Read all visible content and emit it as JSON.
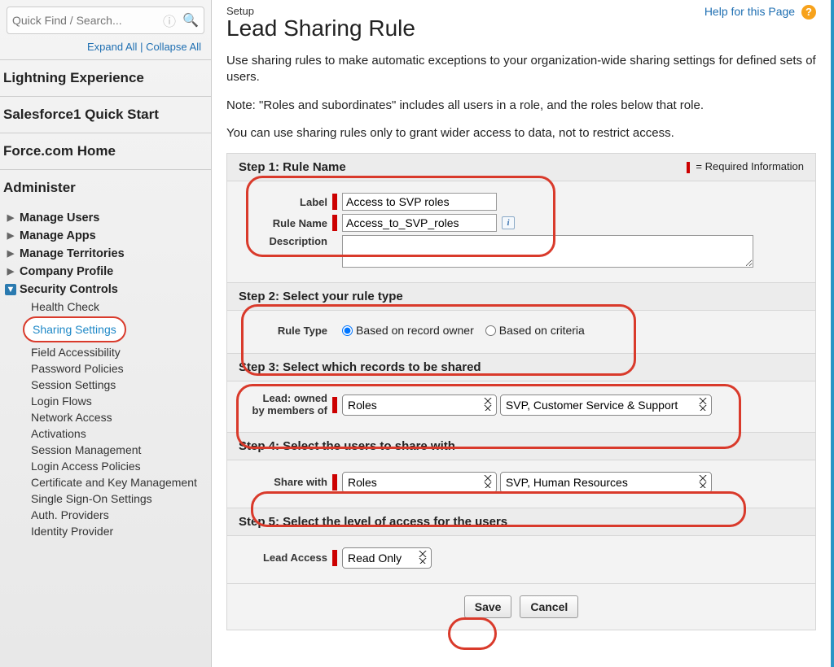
{
  "sidebar": {
    "search_placeholder": "Quick Find / Search...",
    "expand_all": "Expand All",
    "collapse_all": "Collapse All",
    "sections": [
      {
        "label": "Lightning Experience"
      },
      {
        "label": "Salesforce1 Quick Start"
      },
      {
        "label": "Force.com Home"
      }
    ],
    "administer_label": "Administer",
    "tree": [
      {
        "label": "Manage Users",
        "expanded": false
      },
      {
        "label": "Manage Apps",
        "expanded": false
      },
      {
        "label": "Manage Territories",
        "expanded": false
      },
      {
        "label": "Company Profile",
        "expanded": false
      },
      {
        "label": "Security Controls",
        "expanded": true,
        "children": [
          "Health Check",
          "Sharing Settings",
          "Field Accessibility",
          "Password Policies",
          "Session Settings",
          "Login Flows",
          "Network Access",
          "Activations",
          "Session Management",
          "Login Access Policies",
          "Certificate and Key Management",
          "Single Sign-On Settings",
          "Auth. Providers",
          "Identity Provider"
        ],
        "active_child_index": 1
      }
    ]
  },
  "header": {
    "crumb": "Setup",
    "title": "Lead Sharing Rule",
    "help_text": "Help for this Page"
  },
  "intro": {
    "p1": "Use sharing rules to make automatic exceptions to your organization-wide sharing settings for defined sets of users.",
    "p2": "Note: \"Roles and subordinates\" includes all users in a role, and the roles below that role.",
    "p3": "You can use sharing rules only to grant wider access to data, not to restrict access."
  },
  "steps": {
    "s1_title": "Step 1: Rule Name",
    "req_legend": "= Required Information",
    "label_lbl": "Label",
    "label_val": "Access to SVP roles",
    "rulename_lbl": "Rule Name",
    "rulename_val": "Access_to_SVP_roles",
    "description_lbl": "Description",
    "description_val": "",
    "s2_title": "Step 2: Select your rule type",
    "ruletype_lbl": "Rule Type",
    "ruletype_opt1": "Based on record owner",
    "ruletype_opt2": "Based on criteria",
    "ruletype_selected": "owner",
    "s3_title": "Step 3: Select which records to be shared",
    "owned_lbl_1": "Lead: owned",
    "owned_lbl_2": "by members of",
    "owned_sel1": "Roles",
    "owned_sel2": "SVP, Customer Service & Support",
    "s4_title": "Step 4: Select the users to share with",
    "share_lbl": "Share with",
    "share_sel1": "Roles",
    "share_sel2": "SVP, Human Resources",
    "s5_title": "Step 5: Select the level of access for the users",
    "access_lbl": "Lead Access",
    "access_sel": "Read Only"
  },
  "buttons": {
    "save": "Save",
    "cancel": "Cancel"
  }
}
